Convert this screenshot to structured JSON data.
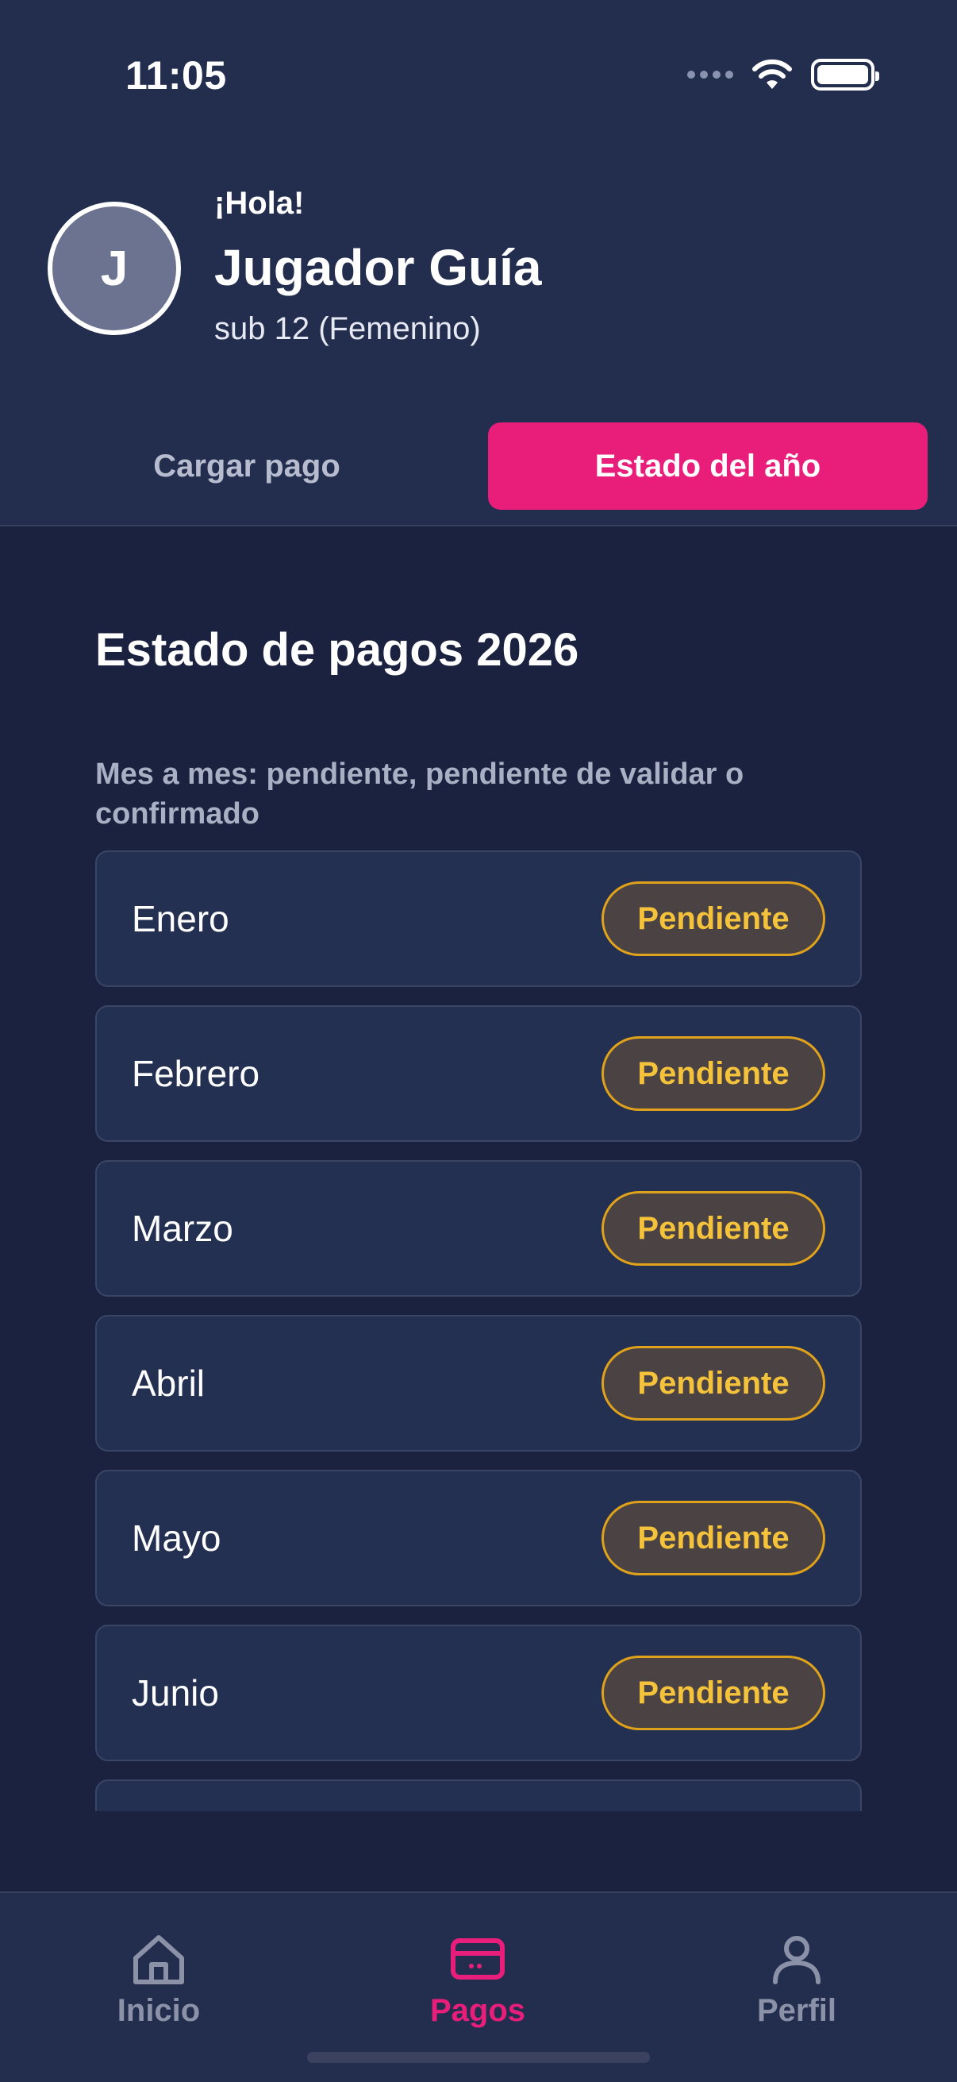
{
  "status_bar": {
    "time": "11:05"
  },
  "header": {
    "avatar_initial": "J",
    "greeting": "¡Hola!",
    "name": "Jugador Guía",
    "subtitle": "sub 12 (Femenino)"
  },
  "tabs": [
    {
      "label": "Cargar pago",
      "active": false
    },
    {
      "label": "Estado del año",
      "active": true
    }
  ],
  "section": {
    "title": "Estado de pagos 2026",
    "description": "Mes a mes: pendiente, pendiente de validar o confirmado"
  },
  "months": [
    {
      "name": "Enero",
      "status": "Pendiente"
    },
    {
      "name": "Febrero",
      "status": "Pendiente"
    },
    {
      "name": "Marzo",
      "status": "Pendiente"
    },
    {
      "name": "Abril",
      "status": "Pendiente"
    },
    {
      "name": "Mayo",
      "status": "Pendiente"
    },
    {
      "name": "Junio",
      "status": "Pendiente"
    },
    {
      "name": "",
      "status": ""
    }
  ],
  "bottom_nav": [
    {
      "label": "Inicio",
      "icon": "home-icon",
      "active": false
    },
    {
      "label": "Pagos",
      "icon": "credit-card-icon",
      "active": true
    },
    {
      "label": "Perfil",
      "icon": "person-icon",
      "active": false
    }
  ],
  "colors": {
    "accent": "#e91e7a",
    "pending_text": "#f5c33b",
    "pending_border": "#e0a21b",
    "background": "#1b2240",
    "card": "#243051"
  }
}
